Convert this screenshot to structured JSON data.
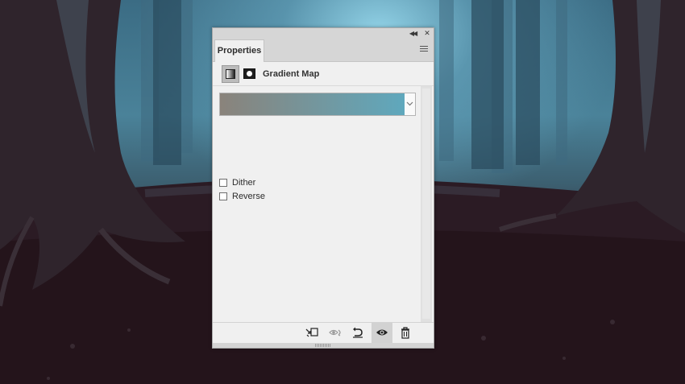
{
  "panel": {
    "tab_label": "Properties",
    "adjustment_title": "Gradient Map",
    "icons": {
      "collapse": "double-chevron-left-icon",
      "close": "close-icon",
      "panel_menu": "hamburger-menu-icon",
      "adjustment": "gradient-map-adjustment-icon",
      "mask": "layer-mask-icon"
    }
  },
  "gradient": {
    "start_color": "#8a837b",
    "end_color": "#5fa8bd",
    "dropdown_icon": "chevron-down-icon"
  },
  "options": {
    "dither_label": "Dither",
    "dither_checked": false,
    "reverse_label": "Reverse",
    "reverse_checked": false
  },
  "footer": {
    "buttons": [
      {
        "name": "clip-to-layer-button",
        "icon": "clip-to-layer-icon"
      },
      {
        "name": "view-previous-state-button",
        "icon": "eye-previous-state-icon"
      },
      {
        "name": "reset-button",
        "icon": "reset-icon"
      },
      {
        "name": "toggle-visibility-button",
        "icon": "eye-icon",
        "active": true
      },
      {
        "name": "delete-button",
        "icon": "trash-icon"
      }
    ]
  }
}
